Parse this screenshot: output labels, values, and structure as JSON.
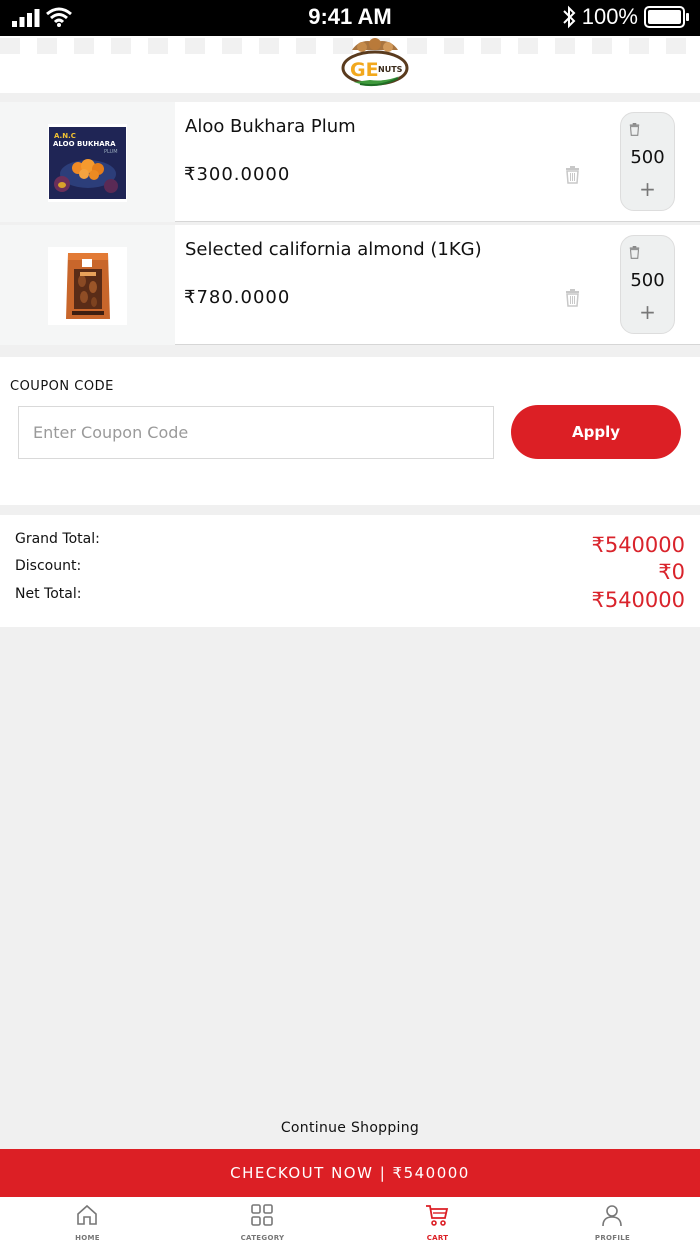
{
  "status_bar": {
    "time": "9:41 AM",
    "battery": "100%"
  },
  "header": {
    "logo_text": "GE",
    "logo_sub": "NUTS"
  },
  "cart": {
    "items": [
      {
        "name": "Aloo Bukhara Plum",
        "price": "₹300.0000",
        "quantity": "500",
        "thumb": {
          "brand": "A.N.C",
          "title": "ALOO BUKHARA",
          "sub": "PLUM"
        }
      },
      {
        "name": "Selected california almond (1KG)",
        "price": "₹780.0000",
        "quantity": "500"
      }
    ],
    "plus": "+"
  },
  "coupon": {
    "label": "COUPON CODE",
    "placeholder": "Enter Coupon Code",
    "value": "",
    "apply_label": "Apply"
  },
  "totals": {
    "grand_total_label": "Grand Total:",
    "grand_total_value": "₹540000",
    "discount_label": "Discount:",
    "discount_value": "₹0",
    "net_total_label": "Net Total:",
    "net_total_value": "₹540000"
  },
  "continue_shopping": "Continue Shopping",
  "checkout_label": "CHECKOUT NOW | ₹540000",
  "tabs": [
    {
      "label": "HOME",
      "icon": "home-icon"
    },
    {
      "label": "CATEGORY",
      "icon": "grid-icon"
    },
    {
      "label": "CART",
      "icon": "cart-icon",
      "active": true
    },
    {
      "label": "PROFILE",
      "icon": "user-icon"
    }
  ],
  "colors": {
    "accent": "#dc1f25",
    "price_red": "#d9232b"
  }
}
